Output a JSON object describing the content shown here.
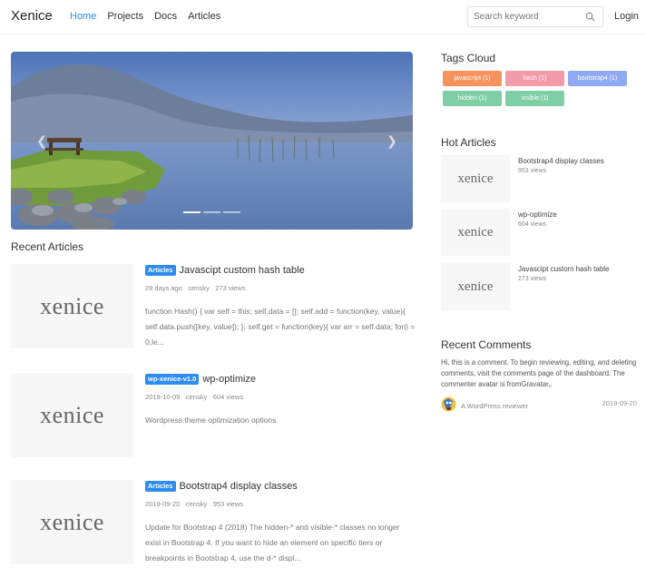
{
  "header": {
    "brand": "Xenice",
    "nav": [
      "Home",
      "Projects",
      "Docs",
      "Articles"
    ],
    "search_placeholder": "Search keyword",
    "login": "Login"
  },
  "hero": {
    "slides": 3,
    "active_slide": 1
  },
  "recent_articles_title": "Recent Articles",
  "articles": [
    {
      "thumb": "xenice",
      "badge": "Articles",
      "title": "Javascipt custom hash table",
      "date": "29 days ago",
      "author": "censky",
      "views": "273 views",
      "excerpt": "function Hash() { var self = this; self.data = []; self.add = function(key, value){ self.data.push([key, value]); }; self.get = function(key){ var arr = self.data; for(i = 0,le..."
    },
    {
      "thumb": "xenice",
      "badge": "wp-xenice-v1.0",
      "title": "wp-optimize",
      "date": "2019-10-09",
      "author": "censky",
      "views": "604 views",
      "excerpt": "Wordpress theme optimization options"
    },
    {
      "thumb": "xenice",
      "badge": "Articles",
      "title": "Bootstrap4 display classes",
      "date": "2019-09-20",
      "author": "censky",
      "views": "953 views",
      "excerpt": "Update for Bootstrap 4 (2018) The hidden-* and visible-* classes no longer exist in Bootstrap 4. If you want to hide an element on specific tiers or breakpoints in Bootstrap 4, use the d-* displ..."
    }
  ],
  "sidebar": {
    "tags_title": "Tags Cloud",
    "tags": [
      {
        "label": "javascript (1)",
        "color": "#f6925d"
      },
      {
        "label": "hash (1)",
        "color": "#f29bab"
      },
      {
        "label": "bootstrap4 (1)",
        "color": "#8fa9f5"
      },
      {
        "label": "hidden (1)",
        "color": "#7ecfa6"
      },
      {
        "label": "visible (1)",
        "color": "#7ecfa6"
      }
    ],
    "hot_title": "Hot Articles",
    "hot": [
      {
        "thumb": "xenice",
        "title": "Bootstrap4 display classes",
        "views": "953 views"
      },
      {
        "thumb": "xenice",
        "title": "wp-optimize",
        "views": "604 views"
      },
      {
        "thumb": "xenice",
        "title": "Javascipt custom hash table",
        "views": "273 views"
      }
    ],
    "comments_title": "Recent Comments",
    "comment": {
      "text": "Hi, this is a comment. To begin reviewing, editing, and deleting comments, visit the comments page of the dashboard. The commenter avatar is fromGravatar。",
      "author": "A WordPress reviewer",
      "date": "2019-09-20"
    }
  },
  "colors": {
    "accent": "#2d8cf0"
  }
}
